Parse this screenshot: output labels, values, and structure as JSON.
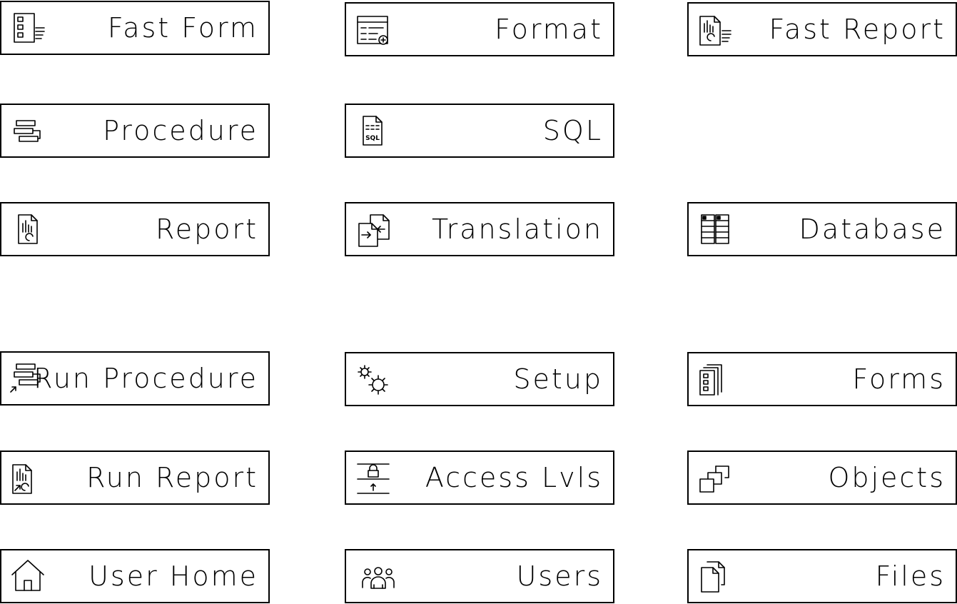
{
  "accent_color": "#000000",
  "background_color": "#ffffff",
  "tiles": {
    "fast_form": {
      "label": "Fast Form",
      "icon": "form-list-icon"
    },
    "format": {
      "label": "Format",
      "icon": "format-table-icon"
    },
    "fast_report": {
      "label": "Fast Report",
      "icon": "fast-report-icon"
    },
    "procedure": {
      "label": "Procedure",
      "icon": "procedure-stack-icon"
    },
    "sql": {
      "label": "SQL",
      "icon": "sql-file-icon",
      "icon_text": "SQL"
    },
    "report": {
      "label": "Report",
      "icon": "report-file-icon"
    },
    "translation": {
      "label": "Translation",
      "icon": "translation-icon"
    },
    "database": {
      "label": "Database",
      "icon": "database-table-icon"
    },
    "run_procedure": {
      "label": "Run Procedure",
      "icon": "run-procedure-icon"
    },
    "setup": {
      "label": "Setup",
      "icon": "gears-icon"
    },
    "forms": {
      "label": "Forms",
      "icon": "forms-stack-icon"
    },
    "run_report": {
      "label": "Run Report",
      "icon": "run-report-icon"
    },
    "access_lvls": {
      "label": "Access Lvls",
      "icon": "lock-levels-icon"
    },
    "objects": {
      "label": "Objects",
      "icon": "objects-cascade-icon"
    },
    "user_home": {
      "label": "User Home",
      "icon": "home-icon"
    },
    "users": {
      "label": "Users",
      "icon": "users-group-icon"
    },
    "files": {
      "label": "Files",
      "icon": "files-icon"
    }
  }
}
